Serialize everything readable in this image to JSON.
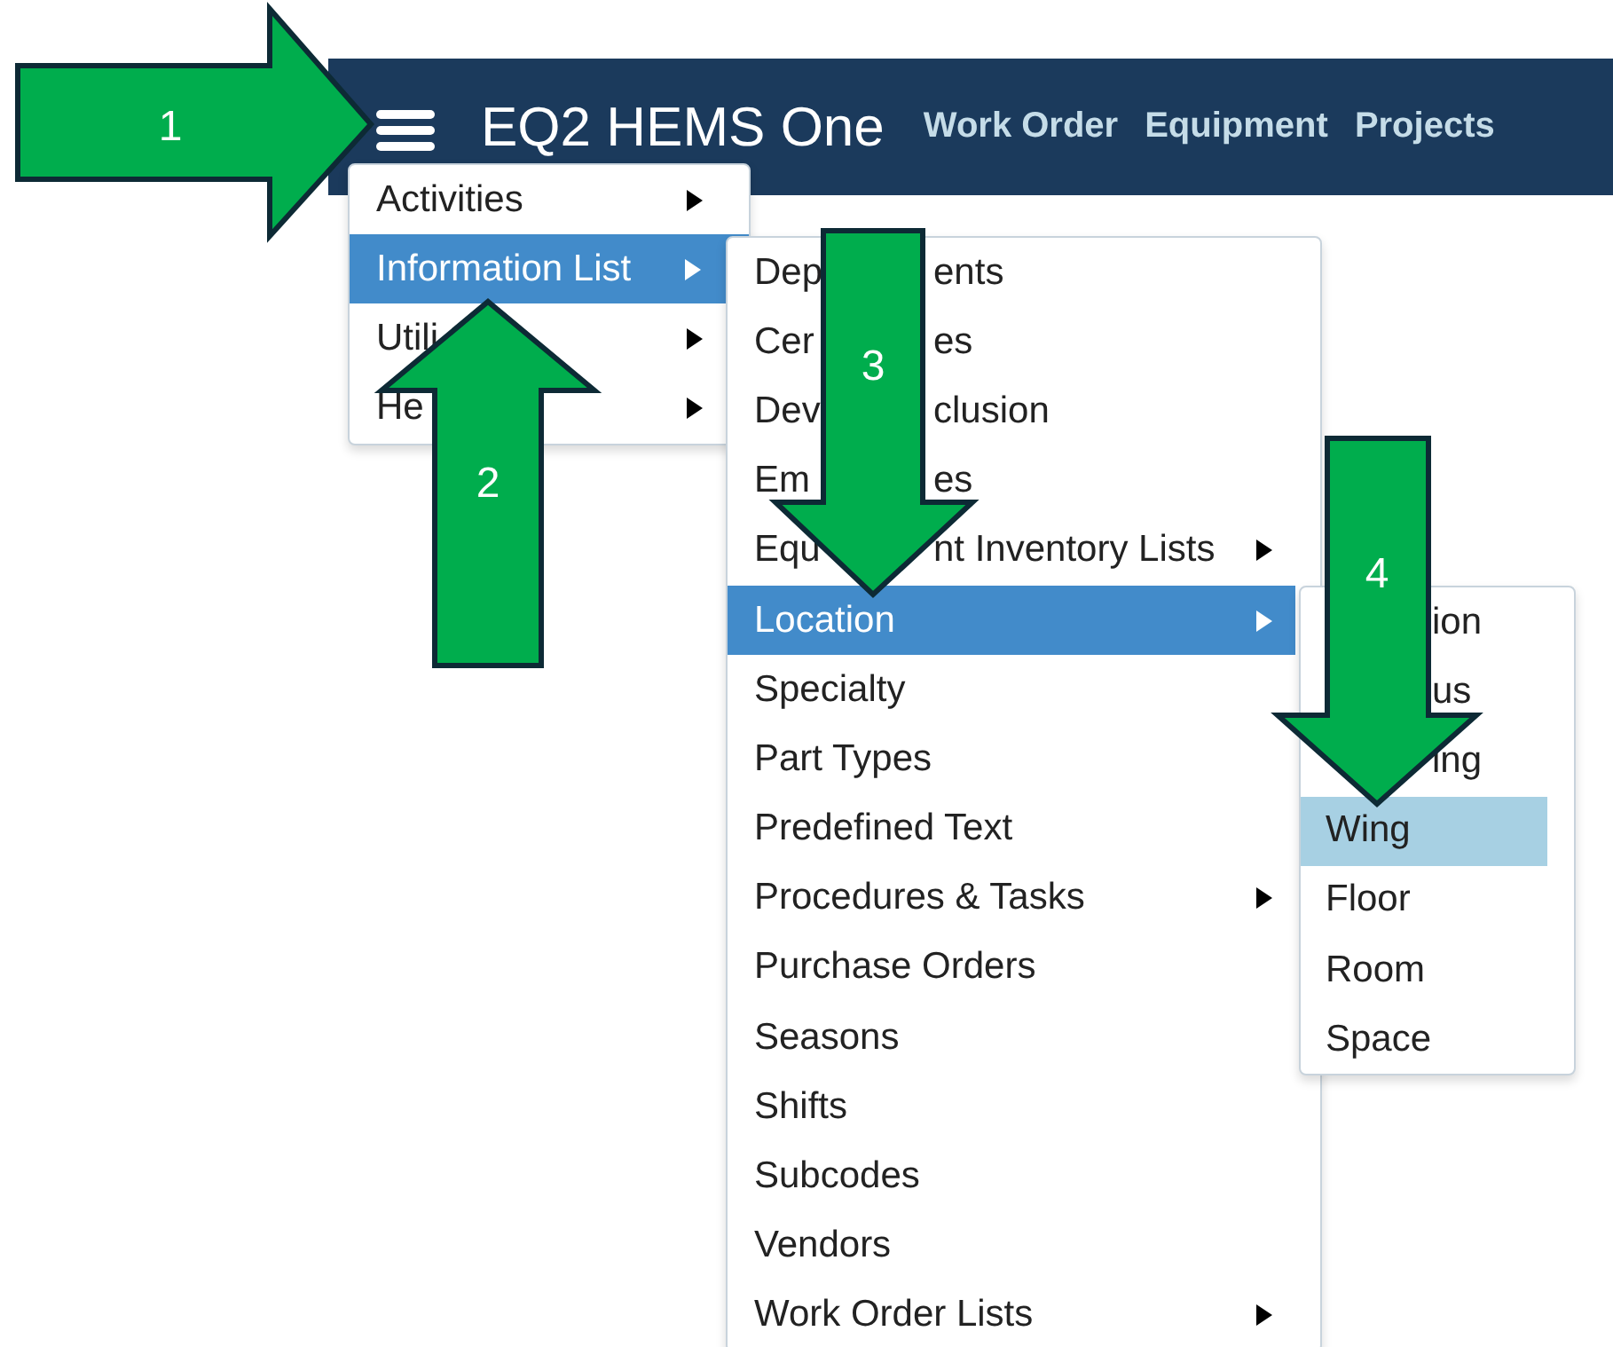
{
  "navbar": {
    "title": "EQ2 HEMS One",
    "links": [
      "Work Order",
      "Equipment",
      "Projects"
    ]
  },
  "menus": [
    {
      "items": [
        {
          "label": "Activities",
          "submenu": true,
          "selected": false
        },
        {
          "label": "Information List",
          "submenu": true,
          "selected": true
        },
        {
          "label": "Utili",
          "submenu": true,
          "selected": false
        },
        {
          "label": "He",
          "submenu": true,
          "selected": false
        }
      ]
    },
    {
      "items": [
        {
          "label": "Dep",
          "label_end": "ents",
          "submenu": false,
          "selected": false
        },
        {
          "label": "Cer",
          "label_end": "es",
          "submenu": false,
          "selected": false
        },
        {
          "label": "Dev",
          "label_end": "clusion",
          "submenu": false,
          "selected": false
        },
        {
          "label": "Em",
          "label_end": "es",
          "submenu": false,
          "selected": false
        },
        {
          "label": "Equ",
          "label_end": "nt Inventory Lists",
          "submenu": true,
          "selected": false
        },
        {
          "label": "Location",
          "submenu": true,
          "selected": true
        },
        {
          "label": "Specialty",
          "submenu": false,
          "selected": false
        },
        {
          "label": "Part Types",
          "submenu": false,
          "selected": false
        },
        {
          "label": "Predefined Text",
          "submenu": false,
          "selected": false
        },
        {
          "label": "Procedures & Tasks",
          "submenu": true,
          "selected": false
        },
        {
          "label": "Purchase Orders",
          "submenu": false,
          "selected": false
        },
        {
          "label": "Seasons",
          "submenu": false,
          "selected": false
        },
        {
          "label": "Shifts",
          "submenu": false,
          "selected": false
        },
        {
          "label": "Subcodes",
          "submenu": false,
          "selected": false
        },
        {
          "label": "Vendors",
          "submenu": false,
          "selected": false
        },
        {
          "label": "Work Order Lists",
          "submenu": true,
          "selected": false
        }
      ]
    },
    {
      "items": [
        {
          "label_end": "ion",
          "submenu": false,
          "selected": false
        },
        {
          "label_end": "us",
          "submenu": false,
          "selected": false
        },
        {
          "label_end": "ing",
          "submenu": false,
          "selected": false
        },
        {
          "label": "Wing",
          "submenu": false,
          "selected": true
        },
        {
          "label": "Floor",
          "submenu": false,
          "selected": false
        },
        {
          "label": "Room",
          "submenu": false,
          "selected": false
        },
        {
          "label": "Space",
          "submenu": false,
          "selected": false
        }
      ]
    }
  ],
  "steps": [
    "1",
    "2",
    "3",
    "4"
  ]
}
